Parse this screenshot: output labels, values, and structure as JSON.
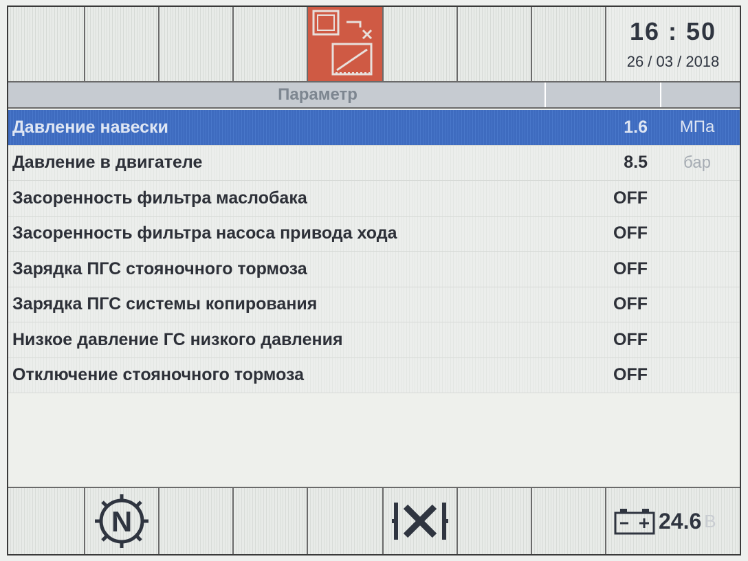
{
  "clock": {
    "time": "16 : 50",
    "date": "26 / 03 / 2018"
  },
  "top_bar": {
    "active_icon": "implement-mode-icon",
    "active_color": "#cf5a44"
  },
  "table": {
    "header": "Параметр",
    "rows": [
      {
        "label": "Давление навески",
        "value": "1.6",
        "unit": "МПа",
        "selected": true
      },
      {
        "label": "Давление в двигателе",
        "value": "8.5",
        "unit": "бар"
      },
      {
        "label": "Засоренность фильтра маслобака",
        "value": "OFF",
        "unit": ""
      },
      {
        "label": "Засоренность фильтра насоса привода хода",
        "value": "OFF",
        "unit": ""
      },
      {
        "label": "Зарядка ПГС стояночного тормоза",
        "value": "OFF",
        "unit": ""
      },
      {
        "label": "Зарядка ПГС системы копирования",
        "value": "OFF",
        "unit": ""
      },
      {
        "label": "Низкое давление ГС низкого давления",
        "value": "OFF",
        "unit": ""
      },
      {
        "label": "Отключение стояночного тормоза",
        "value": "OFF",
        "unit": ""
      }
    ],
    "selected_color": "#4472c4"
  },
  "bottom_bar": {
    "gear": {
      "letter": "N",
      "icon": "neutral-gear-icon"
    },
    "diff_lock_icon": "differential-lock-icon",
    "battery": {
      "icon": "battery-icon",
      "value": "24.6",
      "unit": "В"
    }
  }
}
